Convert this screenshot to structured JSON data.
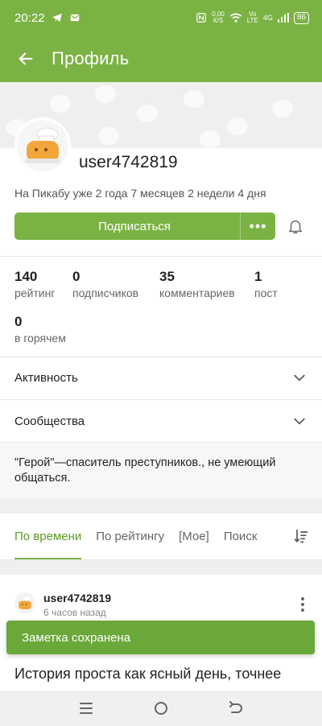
{
  "status_bar": {
    "time": "20:22",
    "speed_top": "0,00",
    "speed_bottom": "К/S",
    "volte_top": "Vo",
    "volte_bottom": "LTE",
    "network": "4G",
    "battery": "86"
  },
  "appbar": {
    "title": "Профиль"
  },
  "profile": {
    "username": "user4742819",
    "since": "На Пикабу уже 2 года 7 месяцев 2 недели 4 дня",
    "subscribe_label": "Подписаться",
    "more_label": "•••"
  },
  "stats": [
    {
      "value": "140",
      "label": "рейтинг"
    },
    {
      "value": "0",
      "label": "подписчиков"
    },
    {
      "value": "35",
      "label": "комментариев"
    },
    {
      "value": "1",
      "label": "пост"
    },
    {
      "value": "0",
      "label": "в горячем"
    }
  ],
  "sections": {
    "activity": "Активность",
    "communities": "Сообщества"
  },
  "bio": "\"Герой\"—спаситель преступников., не умеющий общаться.",
  "tabs": [
    {
      "label": "По времени",
      "active": true
    },
    {
      "label": "По рейтингу",
      "active": false
    },
    {
      "label": "[Мое]",
      "active": false
    },
    {
      "label": "Поиск",
      "active": false
    }
  ],
  "post": {
    "author": "user4742819",
    "time": "6 часов назад",
    "text": "История проста как ясный день, точнее"
  },
  "toast": {
    "text": "Заметка сохранена"
  },
  "colors": {
    "accent": "#7bb244",
    "toast": "#6aa83a",
    "active_tab": "#5b9b1f"
  }
}
